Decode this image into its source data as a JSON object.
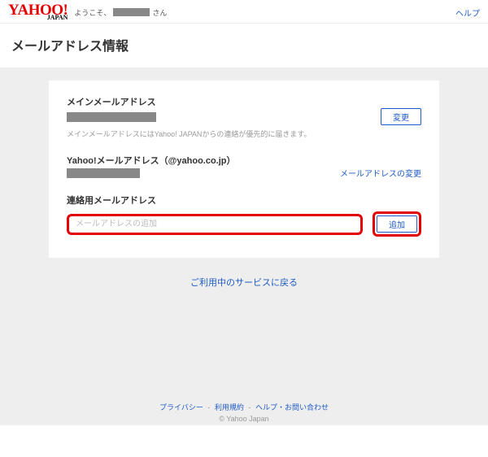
{
  "header": {
    "logo_main": "YAHOO!",
    "logo_sub": "JAPAN",
    "greeting_prefix": "ようこそ、",
    "greeting_suffix": "さん",
    "help": "ヘルプ"
  },
  "page_title": "メールアドレス情報",
  "main_email": {
    "title": "メインメールアドレス",
    "change_btn": "変更",
    "desc": "メインメールアドレスにはYahoo! JAPANからの連絡が優先的に届きます。"
  },
  "yahoo_email": {
    "title": "Yahoo!メールアドレス（@yahoo.co.jp）",
    "change_link": "メールアドレスの変更"
  },
  "contact_email": {
    "title": "連絡用メールアドレス",
    "placeholder": "メールアドレスの追加",
    "add_btn": "追加"
  },
  "back_link": "ご利用中のサービスに戻る",
  "footer": {
    "privacy": "プライバシー",
    "terms": "利用規約",
    "help": "ヘルプ・お問い合わせ",
    "copyright": "© Yahoo Japan"
  }
}
